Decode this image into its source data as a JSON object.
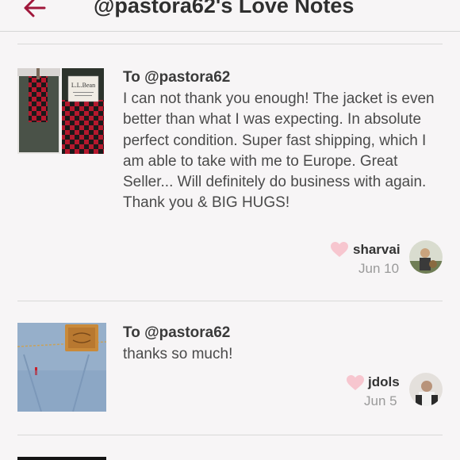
{
  "header": {
    "title": "@pastora62's Love Notes",
    "back_icon": "back-arrow-icon"
  },
  "notes": [
    {
      "recipient": "To @pastora62",
      "message": "I can not thank you enough! The jacket is even better than what I was expecting. In absolute perfect condition. Super fast shipping, which I am able to take with me to Europe. Great Seller... Will definitely do business with again. Thank you & BIG HUGS!",
      "username": "sharvai",
      "date": "Jun 10",
      "thumbnail_label": "L.L.Bean"
    },
    {
      "recipient": "To @pastora62",
      "message": "thanks so much!",
      "username": "jdols",
      "date": "Jun 5"
    }
  ],
  "colors": {
    "accent": "#a0173b",
    "heart": "#f7c6cf"
  }
}
